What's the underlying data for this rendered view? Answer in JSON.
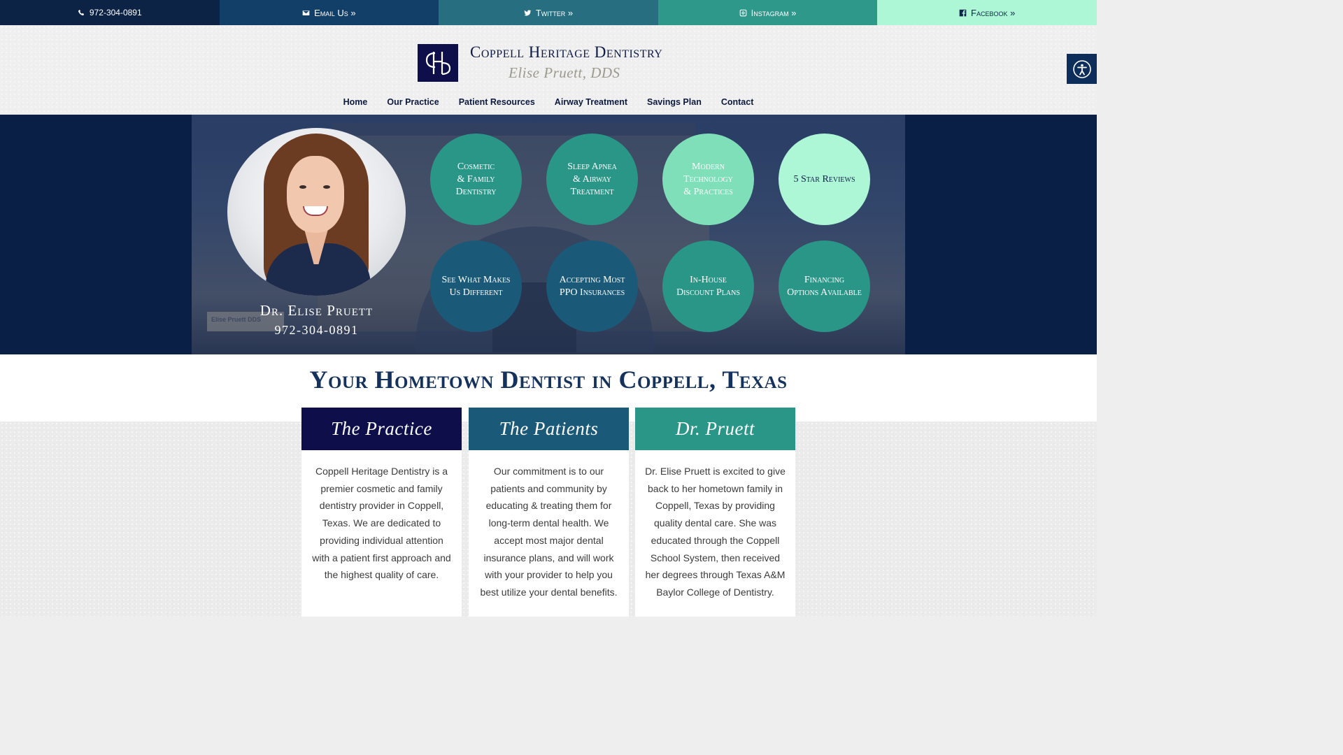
{
  "topbar": {
    "phone": "972-304-0891",
    "email": "Email Us »",
    "twitter": "Twitter »",
    "instagram": "Instagram »",
    "facebook": "Facebook »"
  },
  "brand": {
    "name": "Coppell Heritage Dentistry",
    "subtitle": "Elise Pruett, DDS"
  },
  "nav": [
    "Home",
    "Our Practice",
    "Patient Resources",
    "Airway Treatment",
    "Savings Plan",
    "Contact"
  ],
  "hero": {
    "doctor_name": "Dr. Elise Pruett",
    "doctor_phone": "972-304-0891",
    "sign_text": "Elise Pruett DDS",
    "circles": [
      {
        "label": "Cosmetic\n& Family\nDentistry",
        "color": "#2a9687"
      },
      {
        "label": "Sleep Apnea\n& Airway\nTreatment",
        "color": "#2a9687"
      },
      {
        "label": "Modern\nTechnology\n& Practices",
        "color": "#7edfb9"
      },
      {
        "label": "5 Star Reviews",
        "color": "#aef7d6"
      },
      {
        "label": "See What Makes\nUs Different",
        "color": "#1a5a78"
      },
      {
        "label": "Accepting Most\nPPO Insurances",
        "color": "#1a5a78"
      },
      {
        "label": "In-House\nDiscount Plans",
        "color": "#2a9687"
      },
      {
        "label": "Financing\nOptions Available",
        "color": "#2a9687"
      }
    ]
  },
  "main": {
    "title": "Your Hometown Dentist in Coppell, Texas"
  },
  "cards": [
    {
      "title": "The Practice",
      "color": "#0d0e4a",
      "text": "Coppell Heritage Dentistry is a premier cosmetic and family dentistry provider in Coppell, Texas. We are dedicated to providing individual attention with a patient first approach and the highest quality of care."
    },
    {
      "title": "The Patients",
      "color": "#1a5a78",
      "text": "Our commitment is to our patients and community by educating & treating them for long-term dental health. We accept most major dental insurance plans, and will work with your provider to help you best utilize your dental benefits."
    },
    {
      "title": "Dr. Pruett",
      "color": "#2a9687",
      "text": "Dr. Elise Pruett is excited to give back to her hometown family in Coppell, Texas by providing quality dental care. She was educated through the Coppell School System, then received her degrees through Texas A&M Baylor College of Dentistry."
    }
  ],
  "icons": {
    "phone": "phone-icon",
    "email": "envelope-icon",
    "twitter": "twitter-icon",
    "instagram": "instagram-icon",
    "facebook": "facebook-icon",
    "accessibility": "accessibility-icon"
  }
}
